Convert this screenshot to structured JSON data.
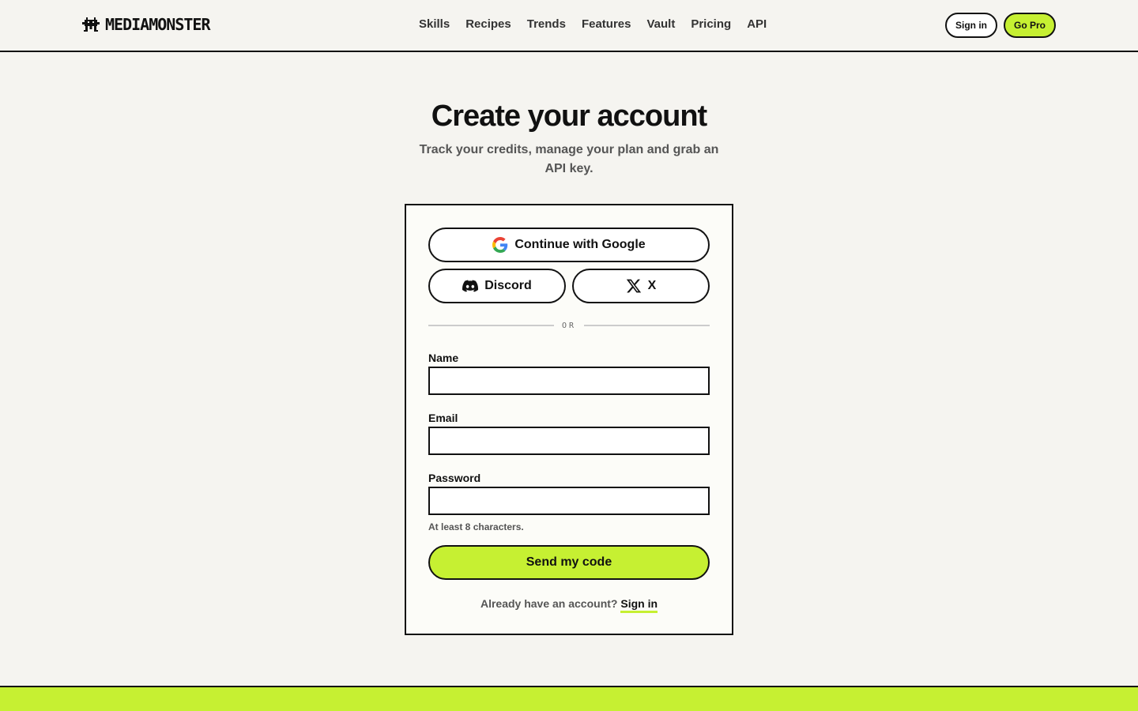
{
  "header": {
    "logo_text": "MEDIAMONSTER",
    "logo_icon": "monster-icon",
    "nav": [
      {
        "label": "Skills"
      },
      {
        "label": "Recipes"
      },
      {
        "label": "Trends"
      },
      {
        "label": "Features"
      },
      {
        "label": "Vault"
      },
      {
        "label": "Pricing"
      },
      {
        "label": "API"
      }
    ],
    "signin_label": "Sign in",
    "gopro_label": "Go Pro"
  },
  "main": {
    "title": "Create your account",
    "subtitle": "Track your credits, manage your plan and grab an API key."
  },
  "card": {
    "google_label": "Continue with Google",
    "discord_label": "Discord",
    "x_label": "X",
    "divider_text": "OR",
    "name_label": "Name",
    "name_value": "",
    "email_label": "Email",
    "email_value": "",
    "password_label": "Password",
    "password_value": "",
    "password_hint": "At least 8 characters.",
    "submit_label": "Send my code",
    "already_text": "Already have an account?",
    "signin_link": "Sign in"
  },
  "colors": {
    "accent": "#c6f032",
    "background": "#f5f4f0",
    "ink": "#111111"
  }
}
